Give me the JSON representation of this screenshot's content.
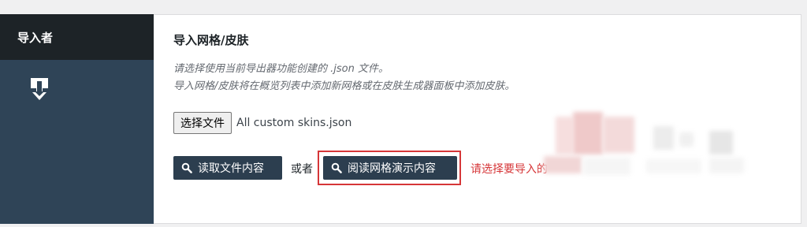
{
  "sidebar": {
    "header_label": "导入者",
    "icon": "import-download-icon"
  },
  "main": {
    "title": "导入网格/皮肤",
    "description_line1": "请选择使用当前导出器功能创建的 .json 文件。",
    "description_line2": "导入网格/皮肤将在概览列表中添加新网格或在皮肤生成器面板中添加皮肤。",
    "file_button_label": "选择文件",
    "file_name": "All custom skins.json",
    "read_file_button_label": "读取文件内容",
    "or_label": "或者",
    "read_demo_button_label": "阅读网格演示内容",
    "error_message": "请选择要导入的",
    "button_icon": "search-icon"
  },
  "colors": {
    "sidebar_header": "#1d2327",
    "sidebar_body": "#2f4457",
    "button_bg": "#2c3e4f",
    "error_red": "#d63638",
    "highlight_red": "#d63638"
  }
}
